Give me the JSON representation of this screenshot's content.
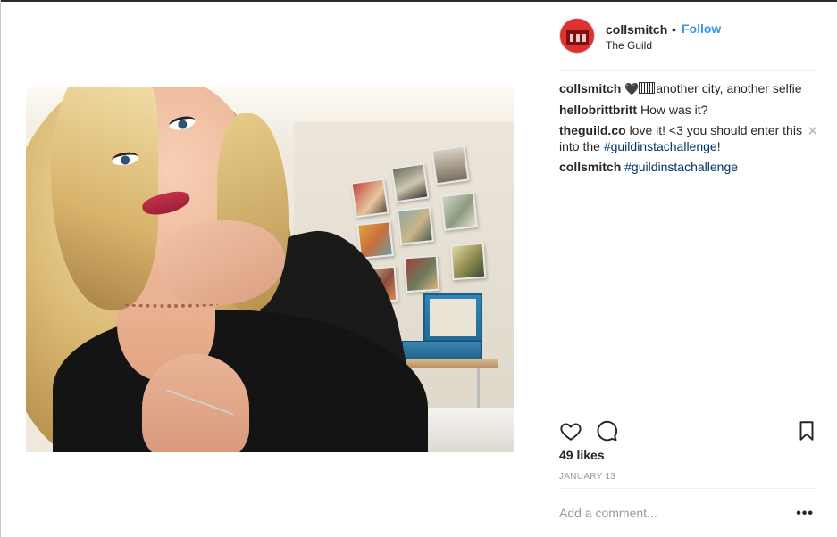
{
  "post": {
    "author": "collsmitch",
    "separator": "•",
    "follow_label": "Follow",
    "location": "The Guild",
    "caption_emoji": "🖤",
    "likes": "49 likes",
    "date": "JANUARY 13",
    "comment_placeholder": "Add a comment...",
    "more_glyph": "•••",
    "close_glyph": "✕"
  },
  "comments": [
    {
      "user": "collsmitch",
      "text": "another city, another selfie",
      "hashtag": ""
    },
    {
      "user": "hellobrittbritt",
      "text": "How was it?",
      "hashtag": ""
    },
    {
      "user": "theguild.co",
      "text": "love it! <3 you should enter this into the ",
      "hashtag": "#guildinstachallenge",
      "suffix": "!"
    },
    {
      "user": "collsmitch",
      "text": "",
      "hashtag": "#guildinstachallenge"
    }
  ],
  "colors": {
    "follow": "#3897f0",
    "hashtag": "#003569",
    "muted": "#999999",
    "avatar": "#e03131"
  },
  "icons": {
    "like": "heart-outline",
    "comment": "speech-bubble-outline",
    "save": "bookmark-outline",
    "more": "ellipsis"
  }
}
